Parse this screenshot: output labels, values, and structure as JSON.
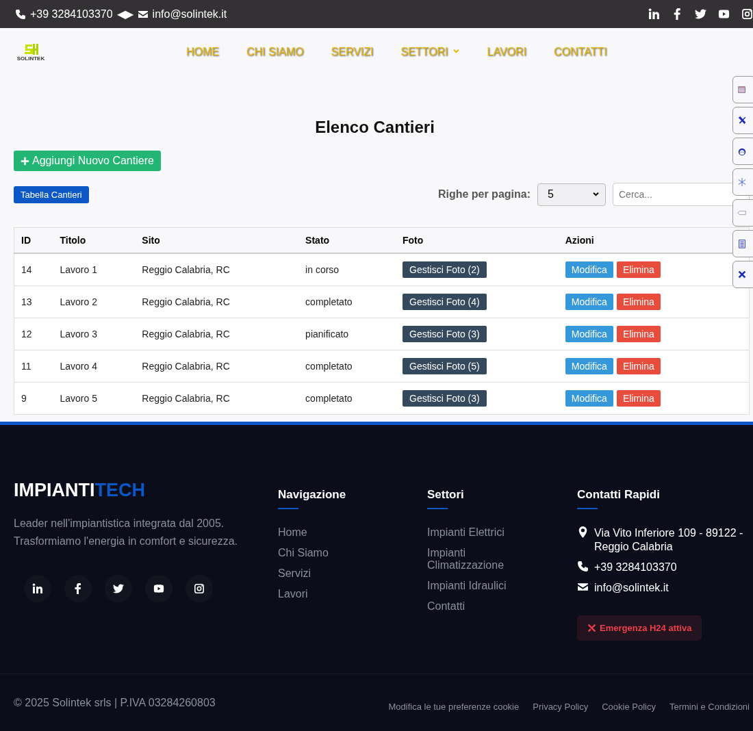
{
  "topbar": {
    "phone": "+39 3284103370",
    "separator": "◀▶",
    "email": "info@solintek.it"
  },
  "header": {
    "logo_text": "SOLINTEK",
    "nav": [
      {
        "label": "HOME",
        "dropdown": false
      },
      {
        "label": "CHI SIAMO",
        "dropdown": false
      },
      {
        "label": "SERVIZI",
        "dropdown": false
      },
      {
        "label": "SETTORI",
        "dropdown": true
      },
      {
        "label": "LAVORI",
        "dropdown": false
      },
      {
        "label": "CONTATTI",
        "dropdown": false
      }
    ]
  },
  "page": {
    "title": "Elenco Cantieri",
    "add_button": "Aggiungi Nuovo Cantiere",
    "table_tab": "Tabella Cantieri",
    "rows_label": "Righe per pagina:",
    "rows_value": "5",
    "search": {
      "placeholder": "Cerca..."
    }
  },
  "table": {
    "columns": [
      "ID",
      "Titolo",
      "Sito",
      "Stato",
      "Foto",
      "Azioni"
    ],
    "rows": [
      {
        "id": "14",
        "title": "Lavoro 1",
        "site": "Reggio Calabria, RC",
        "status": "in corso",
        "photos": "Gestisci Foto (2)",
        "edit": "Modifica",
        "delete": "Elimina"
      },
      {
        "id": "13",
        "title": "Lavoro 2",
        "site": "Reggio Calabria, RC",
        "status": "completato",
        "photos": "Gestisci Foto (4)",
        "edit": "Modifica",
        "delete": "Elimina"
      },
      {
        "id": "12",
        "title": "Lavoro 3",
        "site": "Reggio Calabria, RC",
        "status": "pianificato",
        "photos": "Gestisci Foto (3)",
        "edit": "Modifica",
        "delete": "Elimina"
      },
      {
        "id": "11",
        "title": "Lavoro 4",
        "site": "Reggio Calabria, RC",
        "status": "completato",
        "photos": "Gestisci Foto (5)",
        "edit": "Modifica",
        "delete": "Elimina"
      },
      {
        "id": "9",
        "title": "Lavoro 5",
        "site": "Reggio Calabria, RC",
        "status": "completato",
        "photos": "Gestisci Foto (3)",
        "edit": "Modifica",
        "delete": "Elimina"
      }
    ]
  },
  "footer": {
    "brand_a": "IMPIANTI",
    "brand_b": "TECH",
    "about": [
      "Leader nell'impiantistica integrata dal 2005.",
      "Trasformiamo l'energia in comfort e sicurezza."
    ],
    "columns": [
      {
        "title": "Navigazione",
        "links": [
          "Home",
          "Chi Siamo",
          "Servizi",
          "Lavori"
        ]
      },
      {
        "title": "Settori",
        "links": [
          "Impianti Elettrici",
          "Impianti Climatizzazione",
          "Impianti Idraulici",
          "Contatti"
        ]
      }
    ],
    "contacts": {
      "title": "Contatti Rapidi",
      "address": "Via Vito Inferiore 109 - 89122 - Reggio Calabria",
      "phone": "+39 3284103370",
      "email": "info@solintek.it",
      "emergency": "Emergenza H24 attiva"
    },
    "copyright": "© 2025 Solintek srls | P.IVA 03284260803",
    "legal": [
      "Modifica le tue preferenze cookie",
      "Privacy Policy",
      "Cookie Policy",
      "Termini e Condizioni"
    ]
  }
}
